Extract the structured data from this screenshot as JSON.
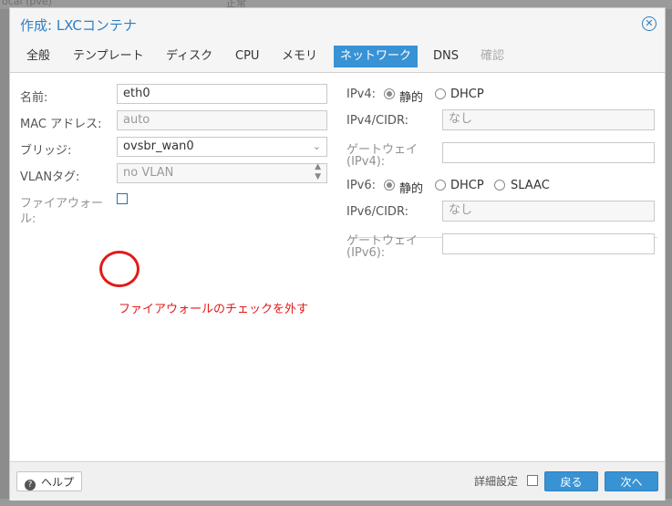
{
  "background": {
    "text_left": "ocal (pve)",
    "text_mid": "正常"
  },
  "dialog": {
    "title": "作成: LXCコンテナ",
    "close_glyph": "✕"
  },
  "tabs": [
    {
      "label": "全般"
    },
    {
      "label": "テンプレート"
    },
    {
      "label": "ディスク"
    },
    {
      "label": "CPU"
    },
    {
      "label": "メモリ"
    },
    {
      "label": "ネットワーク"
    },
    {
      "label": "DNS"
    },
    {
      "label": "確認"
    }
  ],
  "left": {
    "name_label": "名前:",
    "name_value": "eth0",
    "mac_label": "MAC アドレス:",
    "mac_value": "auto",
    "bridge_label": "ブリッジ:",
    "bridge_value": "ovsbr_wan0",
    "vlan_label": "VLANタグ:",
    "vlan_value": "no VLAN",
    "firewall_label_1": "ファイアウォー",
    "firewall_label_2": "ル:"
  },
  "annotation": {
    "text": "ファイアウォールのチェックを外す"
  },
  "right": {
    "ipv4_label": "IPv4:",
    "static_label": "静的",
    "dhcp_label": "DHCP",
    "ipv4_cidr_label": "IPv4/CIDR:",
    "ipv4_cidr_value": "なし",
    "gw4_label_1": "ゲートウェイ",
    "gw4_label_2": "(IPv4):",
    "ipv6_label": "IPv6:",
    "static6_label": "静的",
    "dhcp6_label": "DHCP",
    "slaac_label": "SLAAC",
    "ipv6_cidr_label": "IPv6/CIDR:",
    "ipv6_cidr_value": "なし",
    "gw6_label_1": "ゲートウェイ",
    "gw6_label_2": "(IPv6):"
  },
  "footer": {
    "help_label": "ヘルプ",
    "help_icon": "?",
    "advanced_label": "詳細設定",
    "back_label": "戻る",
    "next_label": "次へ"
  }
}
